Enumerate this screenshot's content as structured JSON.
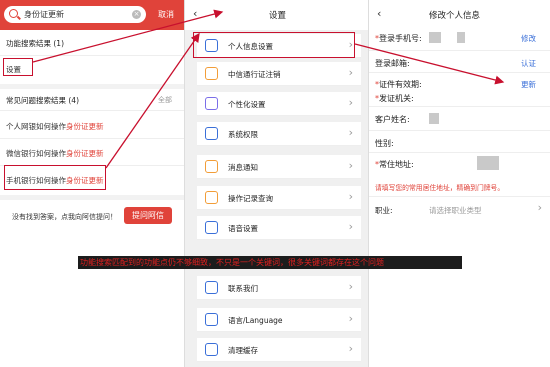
{
  "search": {
    "query": "身份证更新",
    "clear_icon": "clear-icon",
    "cancel_label": "取消"
  },
  "results": {
    "func_title": "功能搜索结果 (1)",
    "func_item": "设置",
    "faq_title": "常见问题搜索结果 (4)",
    "faq_more": "全部",
    "faq_items": [
      {
        "prefix": "个人网银如何操作",
        "highlight": "身份证更新"
      },
      {
        "prefix": "微信银行如何操作",
        "highlight": "身份证更新"
      },
      {
        "prefix": "手机银行如何操作",
        "highlight": "身份证更新"
      }
    ],
    "ask_text": "没有找到答案，点我向阿信提问！",
    "ask_button": "提问阿信"
  },
  "settings": {
    "title": "设置",
    "items": [
      {
        "label": "个人信息设置",
        "icon": "user-icon"
      },
      {
        "label": "中信通行证注销",
        "icon": "passport-icon"
      },
      {
        "label": "个性化设置",
        "icon": "personalize-icon"
      },
      {
        "label": "系统权限",
        "icon": "permission-icon"
      },
      {
        "label": "消息通知",
        "icon": "bell-icon"
      },
      {
        "label": "操作记录查询",
        "icon": "record-icon"
      },
      {
        "label": "语音设置",
        "icon": "voice-icon"
      },
      {
        "label": "联系我们",
        "icon": "headset-icon"
      },
      {
        "label": "语言/Language",
        "icon": "language-icon"
      },
      {
        "label": "清理缓存",
        "icon": "cache-icon"
      }
    ]
  },
  "profile": {
    "title": "修改个人信息",
    "phone_label": "登录手机号:",
    "phone_action": "修改",
    "email_label": "登录邮箱:",
    "email_action": "认证",
    "id_validity_label": "证件有效期:",
    "id_validity_action": "更新",
    "issuer_label": "发证机关:",
    "name_label": "客户姓名:",
    "gender_label": "性别:",
    "address_label": "常住地址:",
    "warning": "请填写您的常用居住地址，精确到门牌号。",
    "job_label": "职业:",
    "job_placeholder": "请选择职业类型"
  },
  "annotation": {
    "banner_text": "功能搜索匹配到的功能点仍不够细致，不只是一个关键词，很多关键词都存在这个问题"
  },
  "colors": {
    "brand_red": "#e0433a",
    "annotation_red": "#c8102e",
    "link_blue": "#3a6fd8"
  }
}
